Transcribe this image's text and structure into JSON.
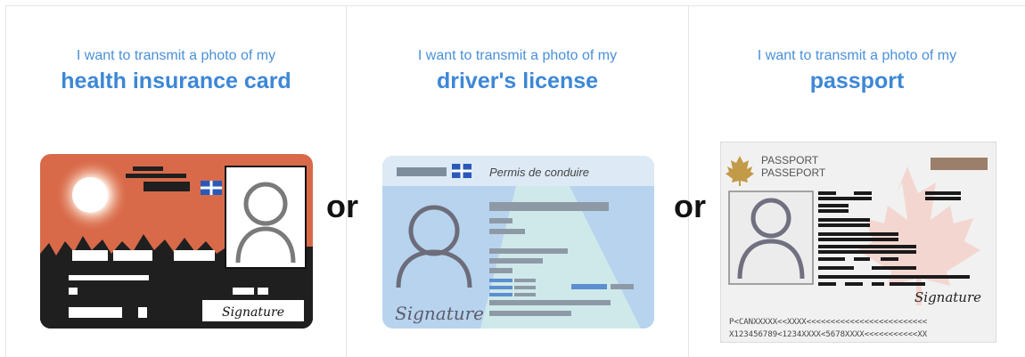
{
  "panels": [
    {
      "intro": "I want to transmit a photo of my",
      "doc": "health insurance card"
    },
    {
      "intro": "I want to transmit a photo of my",
      "doc": "driver's license"
    },
    {
      "intro": "I want to transmit a photo of my",
      "doc": "passport"
    }
  ],
  "separators": [
    "or",
    "or"
  ],
  "cards": {
    "health": {
      "signature": "Signature"
    },
    "license": {
      "title": "Permis de conduire",
      "signature": "Signature"
    },
    "passport": {
      "title_en": "PASSPORT",
      "title_fr": "PASSEPORT",
      "signature": "Signature",
      "mrz1": "P<CANXXXXX<<XXXX<<<<<<<<<<<<<<<<<<<<<<<<<",
      "mrz2": "X123456789<1234XXXX<5678XXXX<<<<<<<<<<<XX"
    }
  },
  "colors": {
    "accent": "#3d87d6",
    "health_sky": "#d86a4a",
    "license_blue": "#b7d3ee"
  }
}
